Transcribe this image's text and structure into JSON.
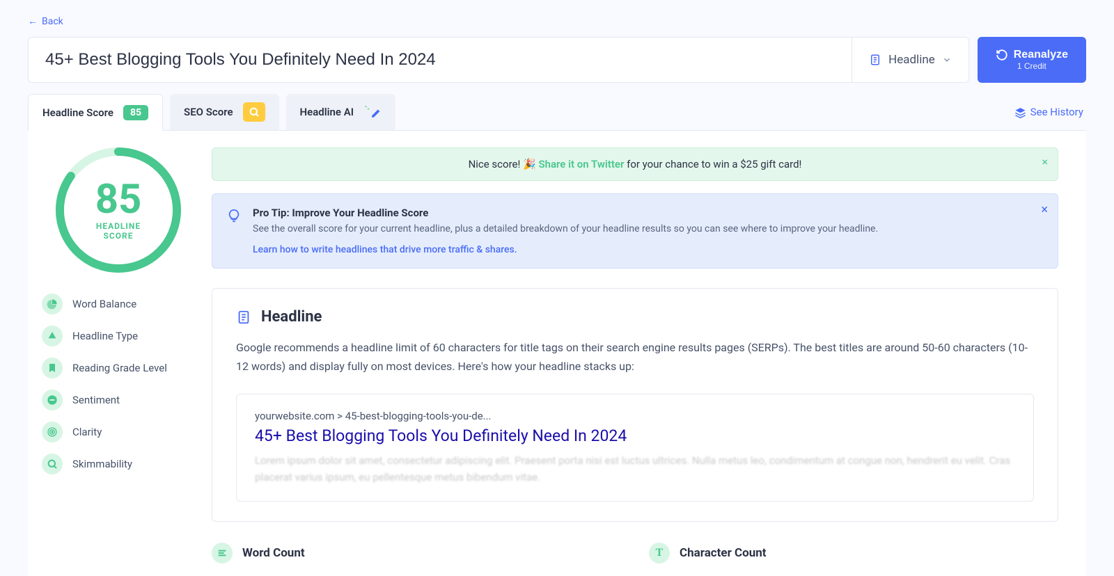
{
  "nav": {
    "back": "Back"
  },
  "input": {
    "headline": "45+ Best Blogging Tools You Definitely Need In 2024",
    "type_label": "Headline"
  },
  "actions": {
    "reanalyze": "Reanalyze",
    "reanalyze_sub": "1 Credit",
    "see_history": "See History"
  },
  "tabs": {
    "headline_score": "Headline Score",
    "headline_score_badge": "85",
    "seo_score": "SEO Score",
    "headline_ai": "Headline AI"
  },
  "score": {
    "value": "85",
    "label_line1": "HEADLINE",
    "label_line2": "SCORE"
  },
  "metrics": [
    "Word Balance",
    "Headline Type",
    "Reading Grade Level",
    "Sentiment",
    "Clarity",
    "Skimmability"
  ],
  "alerts": {
    "green_pre": "Nice score! 🎉 ",
    "green_link": "Share it on Twitter",
    "green_post": " for your chance to win a $25 gift card!",
    "blue_title": "Pro Tip: Improve Your Headline Score",
    "blue_desc": "See the overall score for your current headline, plus a detailed breakdown of your headline results so you can see where to improve your headline.",
    "blue_link": "Learn how to write headlines that drive more traffic & shares."
  },
  "panel": {
    "title": "Headline",
    "desc": "Google recommends a headline limit of 60 characters for title tags on their search engine results pages (SERPs). The best titles are around 50-60 characters (10-12 words) and display fully on most devices. Here's how your headline stacks up:",
    "serp_breadcrumb": "yourwebsite.com > 45-best-blogging-tools-you-de...",
    "serp_title": "45+ Best Blogging Tools You Definitely Need In 2024",
    "serp_placeholder": "Lorem ipsum dolor sit amet, consectetur adipiscing elit. Praesent porta nisi est luctus ultrices. Nulla metus leo, condimentum at congue non, hendrerit eu velit. Cras placerat varius ipsum, eu pellentesque metus bibendum vitae."
  },
  "counts": {
    "word": "Word Count",
    "char": "Character Count"
  }
}
